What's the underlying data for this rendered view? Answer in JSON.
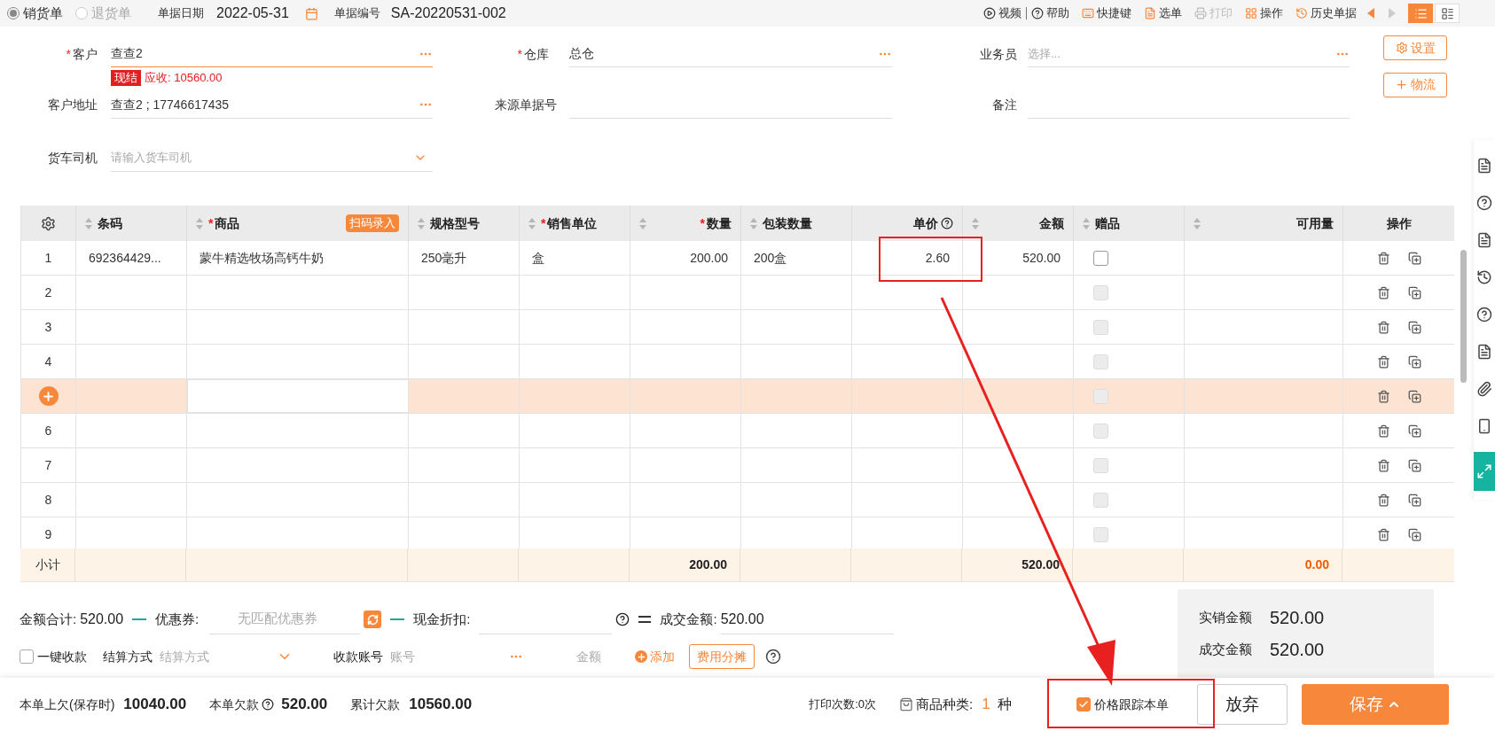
{
  "top_bar": {
    "doc_types": [
      {
        "label": "销货单",
        "selected": true
      },
      {
        "label": "退货单",
        "selected": false
      }
    ],
    "date_label": "单据日期",
    "date": "2022-05-31",
    "number_label": "单据编号",
    "number": "SA-20220531-002",
    "tools": [
      {
        "label": "视频",
        "disabled": false
      },
      {
        "label": "帮助",
        "disabled": false
      },
      {
        "label": "快捷键",
        "disabled": false
      },
      {
        "label": "选单",
        "disabled": false
      },
      {
        "label": "打印",
        "disabled": true
      },
      {
        "label": "操作",
        "disabled": false
      },
      {
        "label": "历史单据",
        "disabled": false
      }
    ],
    "nav": {
      "prev_disabled": false,
      "next_disabled": true
    },
    "views": [
      {
        "selected": true
      },
      {
        "selected": false
      }
    ]
  },
  "form": {
    "customer": {
      "label": "客户",
      "required_mark": "*",
      "value": "查查2",
      "badge": "现结",
      "receivable": "应收: 10560.00"
    },
    "warehouse": {
      "label": "仓库",
      "required_mark": "*",
      "value": "总仓"
    },
    "salesperson": {
      "label": "业务员",
      "placeholder": "选择..."
    },
    "settings_button": "设置",
    "address": {
      "label": "客户地址",
      "value": "查查2 ; 17746617435"
    },
    "source": {
      "label": "来源单据号"
    },
    "remark": {
      "label": "备注"
    },
    "logistics_button": "物流",
    "driver": {
      "label": "货车司机",
      "placeholder": "请输入货车司机"
    }
  },
  "table": {
    "columns": [
      {
        "label": "条码",
        "sortable": true
      },
      {
        "label": "商品",
        "required_mark": "*",
        "sortable": true,
        "badge": "扫码录入"
      },
      {
        "label": "规格型号",
        "sortable": true
      },
      {
        "label": "销售单位",
        "required_mark": "*",
        "sortable": true
      },
      {
        "label": "数量",
        "required_mark": "*",
        "sortable": true
      },
      {
        "label": "包装数量",
        "sortable": true
      },
      {
        "label": "单价",
        "sortable": false,
        "help": true
      },
      {
        "label": "金额",
        "sortable": true
      },
      {
        "label": "赠品",
        "sortable": true
      },
      {
        "label": "可用量",
        "sortable": true
      }
    ],
    "ops_label": "操作",
    "rows": [
      {
        "no": "1",
        "cells": [
          "692364429...",
          "蒙牛精选牧场高钙牛奶",
          "250毫升",
          "盒",
          "200.00",
          "200盒",
          "2.60",
          "520.00",
          ""
        ],
        "gift": {
          "checked": false,
          "disabled": false
        },
        "selected": false
      },
      {
        "no": "2",
        "cells": [],
        "gift": {
          "checked": false,
          "disabled": true
        },
        "selected": false
      },
      {
        "no": "3",
        "cells": [],
        "gift": {
          "checked": false,
          "disabled": true
        },
        "selected": false
      },
      {
        "no": "4",
        "cells": [],
        "gift": {
          "checked": false,
          "disabled": true
        },
        "selected": false
      },
      {
        "cells": [],
        "gift": {
          "checked": false,
          "disabled": true
        },
        "selected": true
      },
      {
        "no": "6",
        "cells": [],
        "gift": {
          "checked": false,
          "disabled": true
        },
        "selected": false
      },
      {
        "no": "7",
        "cells": [],
        "gift": {
          "checked": false,
          "disabled": true
        },
        "selected": false
      },
      {
        "no": "8",
        "cells": [],
        "gift": {
          "checked": false,
          "disabled": true
        },
        "selected": false
      },
      {
        "no": "9",
        "cells": [],
        "gift": {
          "checked": false,
          "disabled": true
        },
        "selected": false
      }
    ],
    "subtotal": {
      "label": "小计",
      "qty": "200.00",
      "amount": "520.00",
      "available": "0.00"
    }
  },
  "summary": {
    "total_label": "金额合计:",
    "total": "520.00",
    "coupon_label": "优惠券:",
    "coupon_placeholder": "无匹配优惠券",
    "discount_label": "现金折扣:",
    "deal_label": "成交金额:",
    "deal": "520.00",
    "quick_collect": {
      "label": "一键收款",
      "checked": false
    },
    "settle_label": "结算方式",
    "settle_placeholder": "结算方式",
    "account_label": "收款账号",
    "account_placeholder": "账号",
    "amount_placeholder": "金额",
    "add_label": "添加",
    "split_button": "费用分摊",
    "panel": [
      {
        "label": "实销金额",
        "value": "520.00"
      },
      {
        "label": "成交金额",
        "value": "520.00"
      }
    ]
  },
  "bottom_bar": {
    "prev_debt_label": "本单上欠(保存时)",
    "prev_debt": "10040.00",
    "debt_label": "本单欠款",
    "debt": "520.00",
    "total_debt_label": "累计欠款",
    "total_debt": "10560.00",
    "print_count": "打印次数:0次",
    "kinds_label": "商品种类:",
    "kinds_count": "1",
    "kinds_unit": "种",
    "track": {
      "label": "价格跟踪本单",
      "checked": true
    },
    "discard_button": "放弃",
    "save_button": "保存"
  },
  "side_tools": [
    {
      "selected": false
    },
    {
      "selected": false
    },
    {
      "selected": false
    },
    {
      "selected": false
    },
    {
      "selected": false
    },
    {
      "selected": false
    },
    {
      "selected": false
    },
    {
      "selected": false
    },
    {
      "selected": true
    }
  ]
}
